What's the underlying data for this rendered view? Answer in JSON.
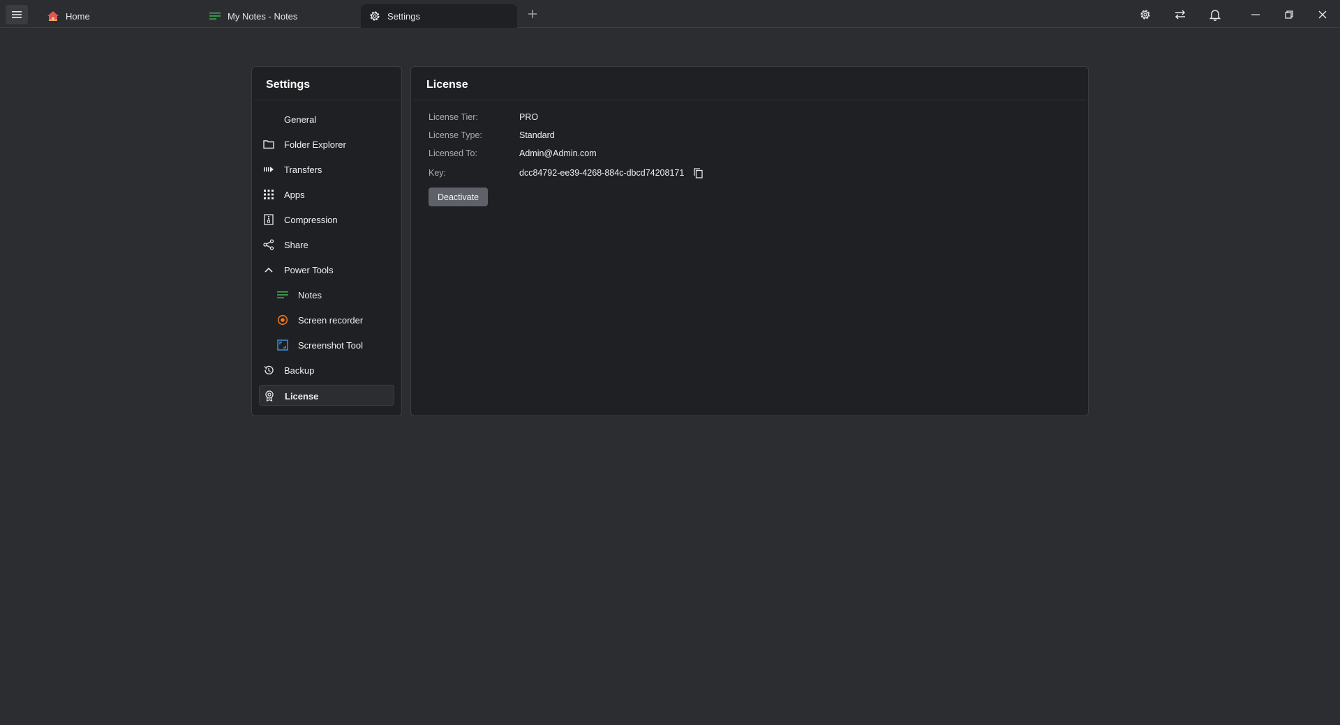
{
  "tabs": [
    {
      "label": "Home",
      "icon": "home-icon"
    },
    {
      "label": "My Notes - Notes",
      "icon": "notes-icon"
    },
    {
      "label": "Settings",
      "icon": "gear-icon",
      "active": true
    }
  ],
  "toolbar": {
    "icons": [
      "gear-icon",
      "transfer-icon",
      "bell-icon",
      "minimize-icon",
      "restore-icon",
      "close-icon"
    ]
  },
  "sidebar": {
    "title": "Settings",
    "items": [
      {
        "label": "General",
        "icon": ""
      },
      {
        "label": "Folder Explorer",
        "icon": "folder-icon"
      },
      {
        "label": "Transfers",
        "icon": "transfers-icon"
      },
      {
        "label": "Apps",
        "icon": "apps-grid-icon"
      },
      {
        "label": "Compression",
        "icon": "compression-icon"
      },
      {
        "label": "Share",
        "icon": "share-icon"
      },
      {
        "label": "Power Tools",
        "icon": "chevron-up-icon"
      },
      {
        "label": "Notes",
        "icon": "notes-icon",
        "color": "#3fb950"
      },
      {
        "label": "Screen recorder",
        "icon": "record-icon",
        "color": "#f0781e"
      },
      {
        "label": "Screenshot Tool",
        "icon": "screenshot-icon",
        "color": "#3d8fe0"
      },
      {
        "label": "Backup",
        "icon": "backup-icon"
      },
      {
        "label": "License",
        "icon": "license-icon",
        "active": true
      }
    ]
  },
  "license": {
    "title": "License",
    "tier_label": "License Tier:",
    "tier_value": "PRO",
    "type_label": "License Type:",
    "type_value": "Standard",
    "to_label": "Licensed To:",
    "to_value": "Admin@Admin.com",
    "key_label": "Key:",
    "key_value": "dcc84792-ee39-4268-884c-dbcd74208171",
    "deactivate_label": "Deactivate"
  },
  "colors": {
    "background": "#2b2d31",
    "panel": "#1f2024",
    "accent_green": "#3fb950",
    "accent_orange": "#f0781e",
    "accent_blue": "#3d8fe0",
    "home_red": "#e0574f"
  }
}
